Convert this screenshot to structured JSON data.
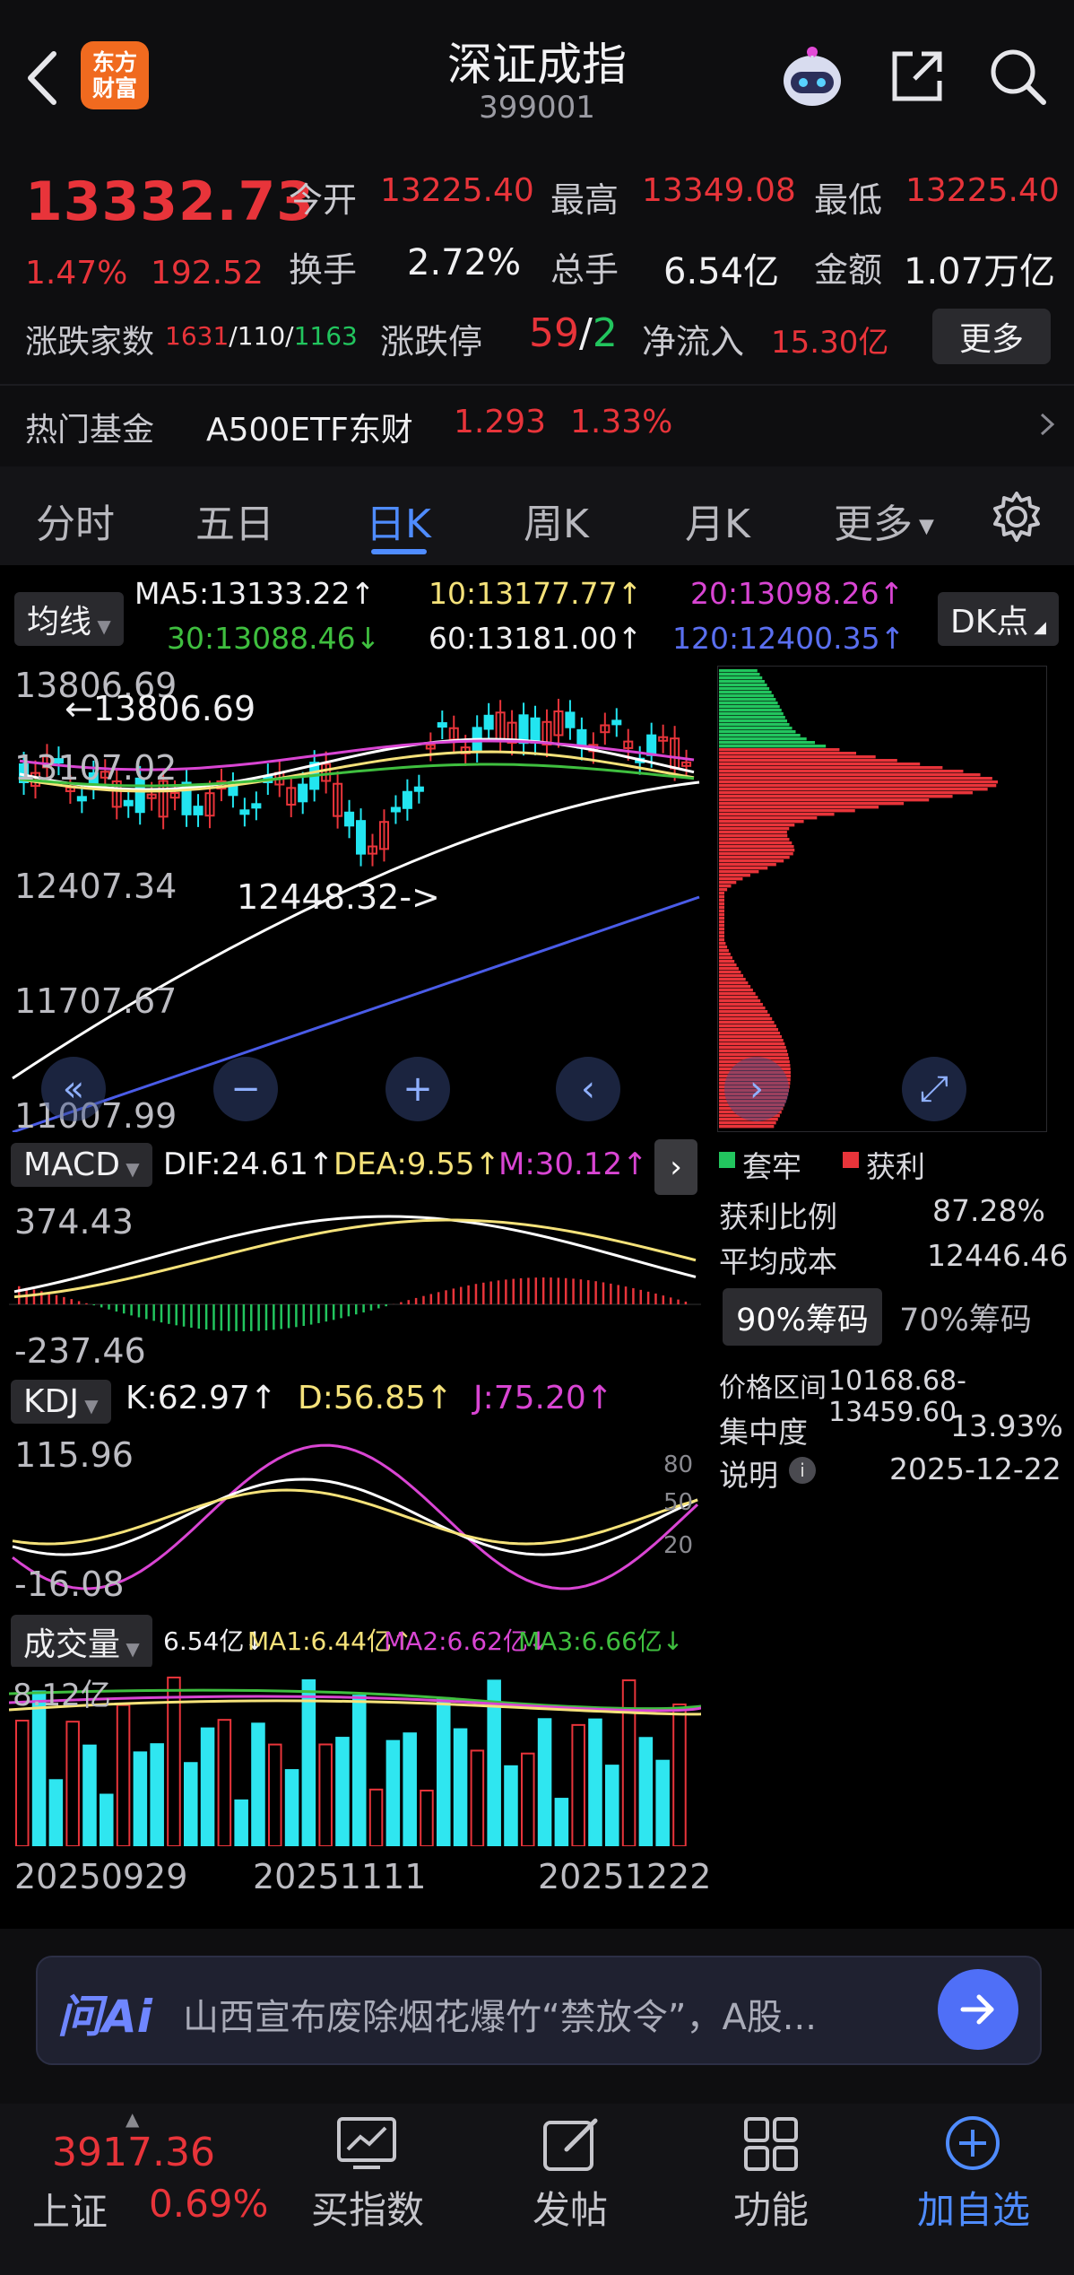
{
  "header": {
    "title": "深证成指",
    "code": "399001"
  },
  "quote": {
    "price": "13332.73",
    "change_pct": "1.47%",
    "change": "192.52",
    "open_label": "今开",
    "open": "13225.40",
    "high_label": "最高",
    "high": "13349.08",
    "low_label": "最低",
    "low": "13225.40",
    "turnover_label": "换手",
    "turnover": "2.72%",
    "volume_label": "总手",
    "volume": "6.54亿",
    "amount_label": "金额",
    "amount": "1.07万亿",
    "adv_label": "涨跌家数",
    "adv_up": "1631",
    "adv_flat": "/110/",
    "adv_down": "1163",
    "limit_label": "涨跌停",
    "limit_up": "59",
    "limit_sep": "/",
    "limit_down": "2",
    "netflow_label": "净流入",
    "netflow": "15.30亿",
    "more_label": "更多"
  },
  "hot_fund": {
    "label": "热门基金",
    "name": "A500ETF东财",
    "price": "1.293",
    "pct": "1.33%"
  },
  "tabs": [
    "分时",
    "五日",
    "日K",
    "周K",
    "月K",
    "更多"
  ],
  "active_tab": "日K",
  "ma": {
    "selector": "均线",
    "ma5": "MA5:13133.22↑",
    "ma10": "10:13177.77↑",
    "ma20": "20:13098.26↑",
    "ma30": "30:13088.46↓",
    "ma60": "60:13181.00↑",
    "ma120": "120:12400.35↑",
    "dk": "DK点"
  },
  "kline": {
    "y_labels": [
      "13806.69",
      "13107.02",
      "12407.34",
      "11707.67",
      "11007.99"
    ],
    "max_note": "←13806.69",
    "min_note": "12448.32->"
  },
  "macd": {
    "label": "MACD",
    "dif": "DIF:24.61↑",
    "dea": "DEA:9.55↑",
    "m": "M:30.12↑",
    "y_top": "374.43",
    "y_bottom": "-237.46"
  },
  "kdj": {
    "label": "KDJ",
    "k": "K:62.97↑",
    "d": "D:56.85↑",
    "j": "J:75.20↑",
    "y_top": "115.96",
    "y_bottom": "-16.08",
    "r80": "80",
    "r50": "50",
    "r20": "20"
  },
  "vol": {
    "label": "成交量",
    "v": "6.54亿↓",
    "ma1": "MA1:6.44亿↑",
    "ma2": "MA2:6.62亿↓",
    "ma3": "MA3:6.66亿↓",
    "y_top": "8.12亿"
  },
  "dates": [
    "20250929",
    "20251111",
    "20251222"
  ],
  "chips": {
    "legend_trapped": "套牢",
    "legend_profit": "获利",
    "profit_ratio_label": "获利比例",
    "profit_ratio": "87.28%",
    "avg_cost_label": "平均成本",
    "avg_cost": "12446.46",
    "tab90": "90%筹码",
    "tab70": "70%筹码",
    "range_label": "价格区间",
    "range": "10168.68-13459.60",
    "concentration_label": "集中度",
    "concentration": "13.93%",
    "note_label": "说明",
    "date": "2025-12-22"
  },
  "ai": {
    "brand": "问Ai",
    "text": "山西宣布废除烟花爆竹“禁放令”，A股..."
  },
  "bottom": {
    "index_price": "3917.36",
    "index_name": "上证",
    "index_pct": "0.69%",
    "items": [
      "买指数",
      "发帖",
      "功能",
      "加自选"
    ]
  },
  "colors": {
    "up": "#e8343a",
    "down": "#22c55e",
    "accent": "#4f8cff",
    "cyan_vol": "#2fe6f0"
  }
}
